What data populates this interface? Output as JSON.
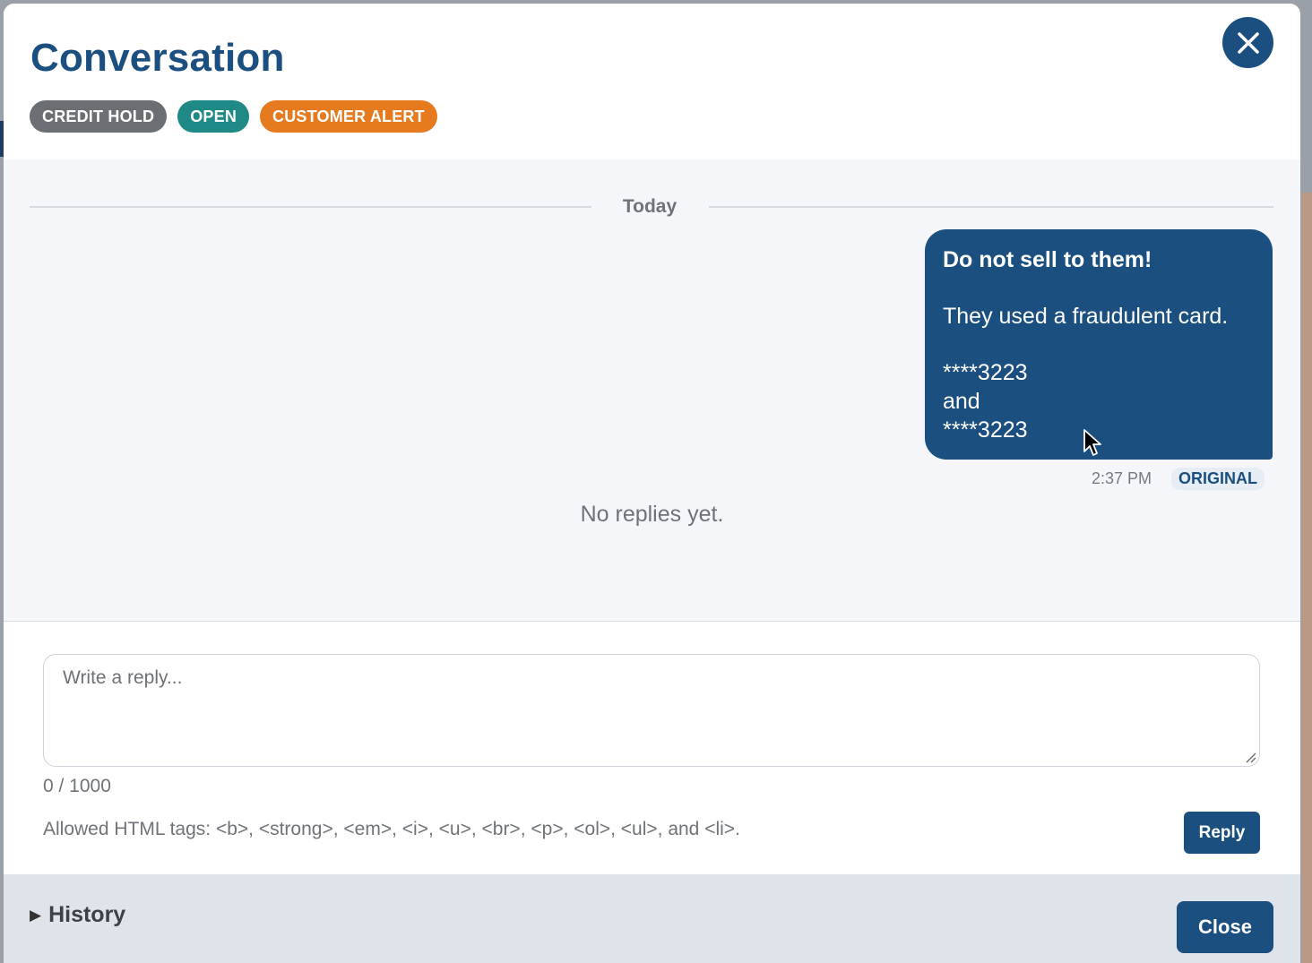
{
  "modal": {
    "title": "Conversation",
    "close_icon": "close-icon"
  },
  "badges": [
    {
      "label": "CREDIT HOLD",
      "color": "#6b6e73"
    },
    {
      "label": "OPEN",
      "color": "#1f8a85"
    },
    {
      "label": "CUSTOMER ALERT",
      "color": "#e57a1e"
    }
  ],
  "thread": {
    "date_divider": "Today",
    "message": {
      "lines": [
        "Do not sell to them!",
        "They used a fraudulent card.",
        "****3223",
        "and",
        "****3223"
      ],
      "time": "2:37 PM",
      "tag": "ORIGINAL"
    },
    "empty_text": "No replies yet."
  },
  "reply": {
    "placeholder": "Write a reply...",
    "counter": "0 / 1000",
    "allowed_tags": "Allowed HTML tags: <b>, <strong>, <em>, <i>, <u>, <br>, <p>, <ol>, <ul>, and <li>.",
    "button_label": "Reply"
  },
  "footer": {
    "history_label": "History",
    "close_label": "Close"
  },
  "colors": {
    "accent": "#1b4f80"
  }
}
